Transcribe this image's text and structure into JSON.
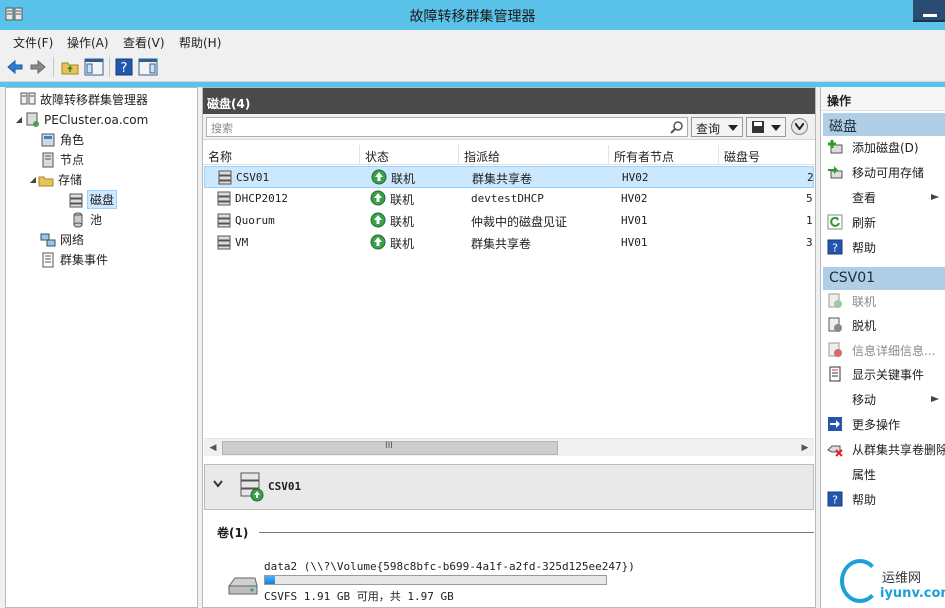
{
  "window": {
    "title": "故障转移群集管理器"
  },
  "menu": [
    "文件(F)",
    "操作(A)",
    "查看(V)",
    "帮助(H)"
  ],
  "toolbar": {
    "icons": [
      "back-icon",
      "forward-icon",
      "up-folder-icon",
      "show-hide-tree-icon",
      "help-icon",
      "show-hide-action-icon"
    ]
  },
  "tree": {
    "root": "故障转移群集管理器",
    "cluster": "PECluster.oa.com",
    "roles": "角色",
    "nodes": "节点",
    "storage": "存储",
    "disks": "磁盘",
    "pools": "池",
    "networks": "网络",
    "events": "群集事件"
  },
  "center": {
    "header": "磁盘(4)",
    "search_placeholder": "搜索",
    "query_label": "查询",
    "columns": [
      "名称",
      "状态",
      "指派给",
      "所有者节点",
      "磁盘号"
    ],
    "rows": [
      {
        "name": "CSV01",
        "status": "联机",
        "assigned": "群集共享卷",
        "owner": "HV02",
        "disk": "2"
      },
      {
        "name": "DHCP2012",
        "status": "联机",
        "assigned": "devtestDHCP",
        "owner": "HV02",
        "disk": "5"
      },
      {
        "name": "Quorum",
        "status": "联机",
        "assigned": "仲裁中的磁盘见证",
        "owner": "HV01",
        "disk": "1"
      },
      {
        "name": "VM",
        "status": "联机",
        "assigned": "群集共享卷",
        "owner": "HV01",
        "disk": "3"
      }
    ],
    "scroll_thumb": "III"
  },
  "detail": {
    "title": "CSV01",
    "volume_header": "卷(1)",
    "volume_name": "data2 (\\\\?\\Volume{598c8bfc-b699-4a1f-a2fd-325d125ee247})",
    "volume_info": "CSVFS 1.91 GB 可用，共 1.97 GB",
    "volume_used_fraction": 0.03
  },
  "actions": {
    "title": "操作",
    "section1": "磁盘",
    "section1_items": [
      {
        "label": "添加磁盘(D)",
        "icon": "add-disk-icon"
      },
      {
        "label": "移动可用存储",
        "icon": "move-storage-icon"
      },
      {
        "label": "查看",
        "icon": ""
      },
      {
        "label": "刷新",
        "icon": "refresh-icon"
      },
      {
        "label": "帮助",
        "icon": "help-icon"
      }
    ],
    "section2": "CSV01",
    "section2_items": [
      {
        "label": "联机",
        "icon": "online-icon",
        "disabled": true
      },
      {
        "label": "脱机",
        "icon": "offline-icon",
        "disabled": false
      },
      {
        "label": "信息详细信息...",
        "icon": "info-details-icon",
        "disabled": true
      },
      {
        "label": "显示关键事件",
        "icon": "critical-events-icon",
        "disabled": false
      },
      {
        "label": "移动",
        "icon": "",
        "disabled": false
      },
      {
        "label": "更多操作",
        "icon": "more-actions-icon",
        "disabled": false
      },
      {
        "label": "从群集共享卷删除",
        "icon": "remove-csv-icon",
        "disabled": false
      },
      {
        "label": "属性",
        "icon": "",
        "disabled": false
      },
      {
        "label": "帮助",
        "icon": "help-icon",
        "disabled": false
      }
    ]
  },
  "watermark": {
    "line1": "运维网",
    "line2": "iyunv.com"
  },
  "colors": {
    "title_bar": "#5bc3ea",
    "pane_header": "#4a4a4a",
    "section_header": "#b0cfe6",
    "selection": "#cce8ff",
    "online_green": "#3aa14a"
  }
}
